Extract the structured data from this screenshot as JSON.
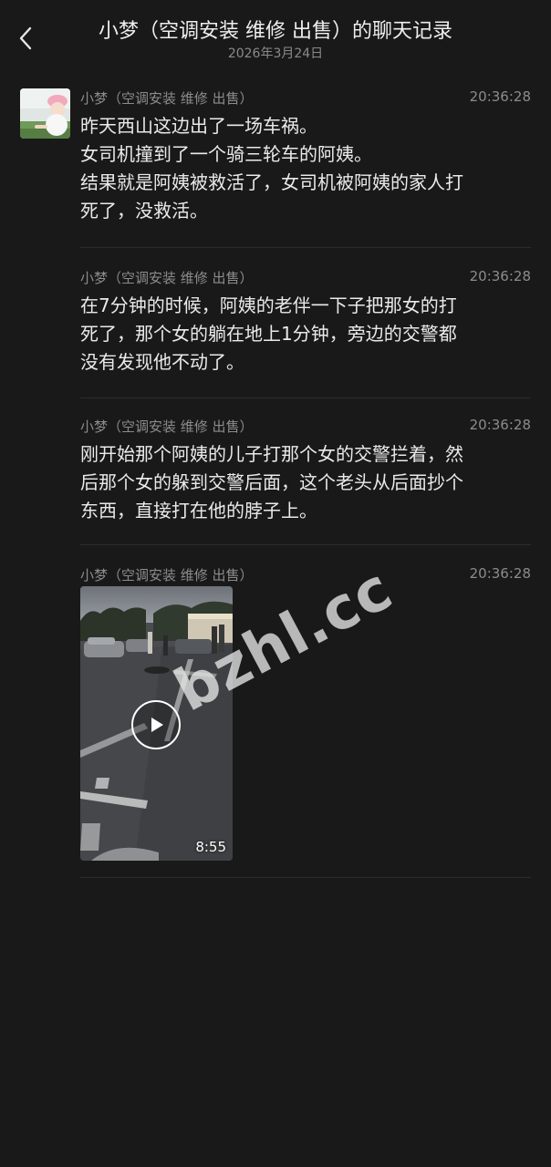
{
  "header": {
    "title": "小梦（空调安装 维修 出售）的聊天记录",
    "date": "2026年3月24日",
    "back_icon": "chevron-left-icon"
  },
  "messages": [
    {
      "sender": "小梦（空调安装 维修 出售）",
      "time": "20:36:28",
      "lines": [
        "昨天西山这边出了一场车祸。",
        "女司机撞到了一个骑三轮车的阿姨。",
        "结果就是阿姨被救活了，女司机被阿姨的家人打",
        "死了，没救活。"
      ]
    },
    {
      "sender": "小梦（空调安装 维修 出售）",
      "time": "20:36:28",
      "lines": [
        "在7分钟的时候，阿姨的老伴一下子把那女的打",
        "死了，那个女的躺在地上1分钟，旁边的交警都",
        "没有发现他不动了。"
      ]
    },
    {
      "sender": "小梦（空调安装 维修 出售）",
      "time": "20:36:28",
      "lines": [
        "刚开始那个阿姨的儿子打那个女的交警拦着，然",
        "后那个女的躲到交警后面，这个老头从后面抄个",
        "东西，直接打在他的脖子上。"
      ]
    },
    {
      "sender": "小梦（空调安装 维修 出售）",
      "time": "20:36:28",
      "video": {
        "duration": "8:55",
        "play_icon": "play-icon"
      }
    }
  ],
  "watermark": "bzhl.cc",
  "colors": {
    "background": "#191919",
    "text": "#eaeaea",
    "meta": "#8c8c8c",
    "divider": "#2c2c2c"
  }
}
